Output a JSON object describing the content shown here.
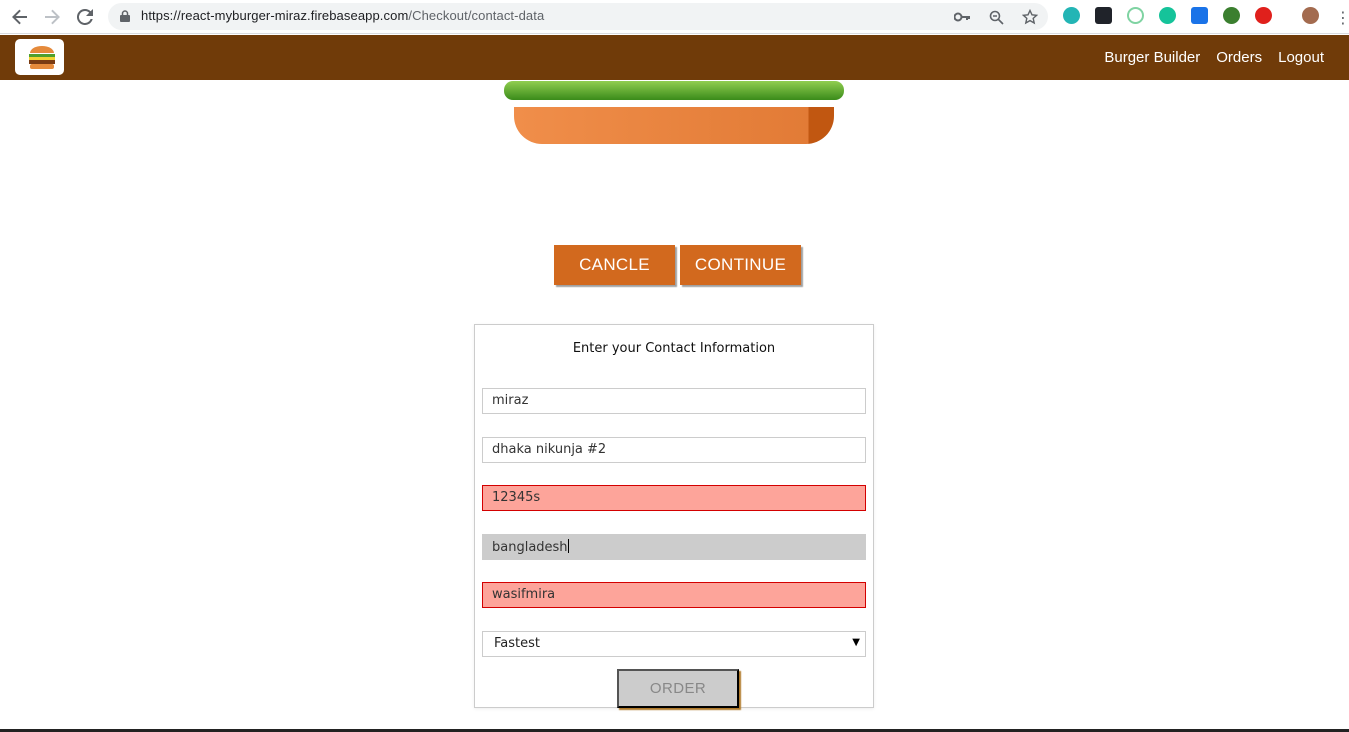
{
  "browser": {
    "url_host": "https://react-myburger-miraz.firebaseapp.com",
    "url_path": "/Checkout/contact-data"
  },
  "toolbar": {
    "nav": [
      {
        "label": "Burger Builder"
      },
      {
        "label": "Orders"
      },
      {
        "label": "Logout"
      }
    ]
  },
  "checkout": {
    "cancel_label": "CANCLE",
    "continue_label": "CONTINUE"
  },
  "contact": {
    "title": "Enter your Contact Information",
    "fields": [
      {
        "value": "miraz",
        "state": "valid"
      },
      {
        "value": "dhaka nikunja #2",
        "state": "valid"
      },
      {
        "value": "12345s",
        "state": "invalid"
      },
      {
        "value": "bangladesh",
        "state": "focused"
      },
      {
        "value": "wasifmira",
        "state": "invalid"
      }
    ],
    "delivery_selected": "Fastest",
    "order_label": "ORDER"
  },
  "colors": {
    "toolbar": "#703b09",
    "button": "#d2691e",
    "invalid": "#fda49a"
  }
}
